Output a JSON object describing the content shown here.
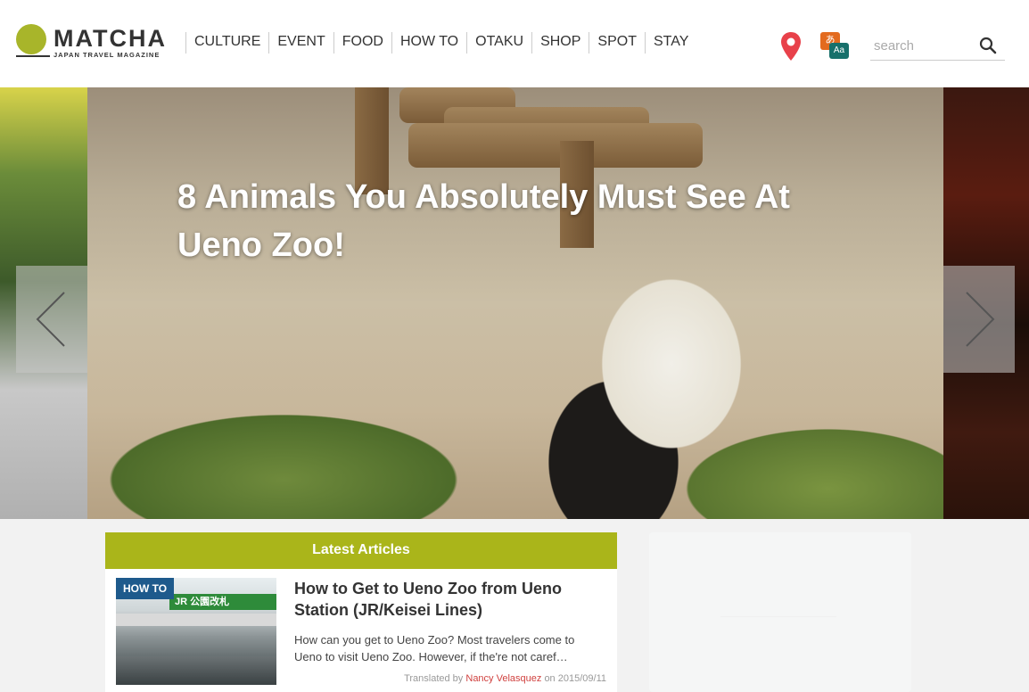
{
  "brand": {
    "name": "MATCHA",
    "tagline": "JAPAN TRAVEL MAGAZINE",
    "color": "#a8b52a"
  },
  "nav": {
    "items": [
      "CULTURE",
      "EVENT",
      "FOOD",
      "HOW TO",
      "OTAKU",
      "SHOP",
      "SPOT",
      "STAY"
    ]
  },
  "header": {
    "map_icon": "map-pin-icon",
    "language_icon": "language-switch-icon",
    "language_a": "あ",
    "language_b": "Aa",
    "search": {
      "placeholder": "search",
      "value": ""
    }
  },
  "carousel": {
    "title": "8 Animals You Absolutely Must See At Ueno Zoo!",
    "prev_icon": "chevron-left-icon",
    "next_icon": "chevron-right-icon"
  },
  "latest": {
    "header": "Latest Articles",
    "header_color": "#aab51a",
    "articles": [
      {
        "category": "HOW TO",
        "category_color": "#1e5a8c",
        "thumb_sign": "JR 公園改札",
        "title": "How to Get to Ueno Zoo from Ueno Station (JR/Keisei Lines)",
        "excerpt": "How can you get to Ueno Zoo? Most travelers come to Ueno to visit Ueno Zoo. However, if the're not caref…",
        "translated_by_label": "Translated by",
        "translator": "Nancy Velasquez",
        "date_prefix": "on",
        "date": "2015/09/11",
        "translator_color": "#d0413f"
      }
    ]
  }
}
